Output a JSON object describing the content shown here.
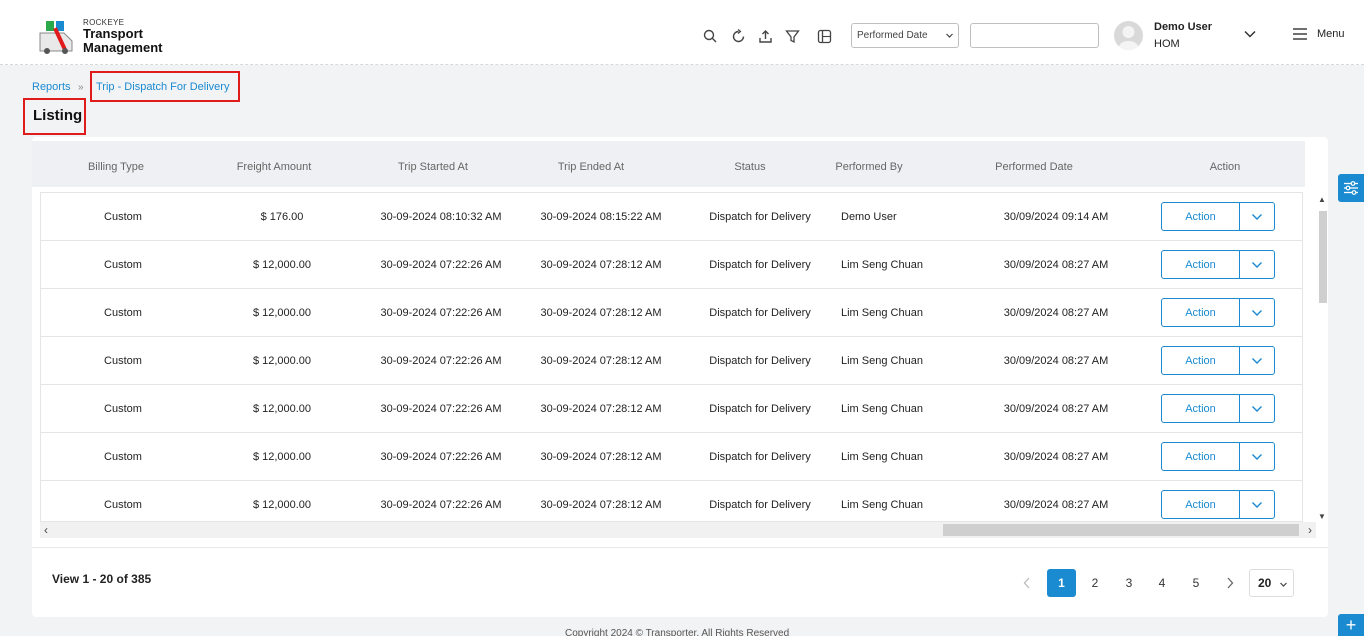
{
  "header": {
    "brand_small": "ROCKEYE",
    "brand_line1": "Transport",
    "brand_line2": "Management",
    "icons": [
      "search-icon",
      "refresh-icon",
      "upload-icon",
      "filter-icon",
      "columns-icon"
    ],
    "date_select": "Performed Date",
    "search_value": "",
    "user_name": "Demo User",
    "user_role": "HOM",
    "menu_label": "Menu"
  },
  "breadcrumb": {
    "parent": "Reports",
    "current": "Trip - Dispatch For Delivery"
  },
  "page_title": "Listing",
  "table": {
    "columns": [
      "Billing Type",
      "Freight Amount",
      "Trip Started At",
      "Trip Ended At",
      "Status",
      "Performed By",
      "Performed Date",
      "Action"
    ],
    "rows": [
      {
        "billing": "Custom",
        "amount": "$ 176.00",
        "started": "30-09-2024 08:10:32 AM",
        "ended": "30-09-2024 08:15:22 AM",
        "status": "Dispatch for Delivery",
        "by": "Demo User",
        "date": "30/09/2024 09:14 AM",
        "action": "Action"
      },
      {
        "billing": "Custom",
        "amount": "$ 12,000.00",
        "started": "30-09-2024 07:22:26 AM",
        "ended": "30-09-2024 07:28:12 AM",
        "status": "Dispatch for Delivery",
        "by": "Lim Seng Chuan",
        "date": "30/09/2024 08:27 AM",
        "action": "Action"
      },
      {
        "billing": "Custom",
        "amount": "$ 12,000.00",
        "started": "30-09-2024 07:22:26 AM",
        "ended": "30-09-2024 07:28:12 AM",
        "status": "Dispatch for Delivery",
        "by": "Lim Seng Chuan",
        "date": "30/09/2024 08:27 AM",
        "action": "Action"
      },
      {
        "billing": "Custom",
        "amount": "$ 12,000.00",
        "started": "30-09-2024 07:22:26 AM",
        "ended": "30-09-2024 07:28:12 AM",
        "status": "Dispatch for Delivery",
        "by": "Lim Seng Chuan",
        "date": "30/09/2024 08:27 AM",
        "action": "Action"
      },
      {
        "billing": "Custom",
        "amount": "$ 12,000.00",
        "started": "30-09-2024 07:22:26 AM",
        "ended": "30-09-2024 07:28:12 AM",
        "status": "Dispatch for Delivery",
        "by": "Lim Seng Chuan",
        "date": "30/09/2024 08:27 AM",
        "action": "Action"
      },
      {
        "billing": "Custom",
        "amount": "$ 12,000.00",
        "started": "30-09-2024 07:22:26 AM",
        "ended": "30-09-2024 07:28:12 AM",
        "status": "Dispatch for Delivery",
        "by": "Lim Seng Chuan",
        "date": "30/09/2024 08:27 AM",
        "action": "Action"
      },
      {
        "billing": "Custom",
        "amount": "$ 12,000.00",
        "started": "30-09-2024 07:22:26 AM",
        "ended": "30-09-2024 07:28:12 AM",
        "status": "Dispatch for Delivery",
        "by": "Lim Seng Chuan",
        "date": "30/09/2024 08:27 AM",
        "action": "Action"
      }
    ]
  },
  "footer": {
    "view_info": "View 1 - 20 of 385",
    "pages": [
      "1",
      "2",
      "3",
      "4",
      "5"
    ],
    "active_page": "1",
    "per_page": "20",
    "copyright": "Copyright 2024 © Transporter. All Rights Reserved"
  },
  "colors": {
    "accent": "#1a8ad1",
    "highlight_border": "#e01b1b",
    "header_row_bg": "#eef0f3",
    "page_bg": "#f2f3f5"
  }
}
